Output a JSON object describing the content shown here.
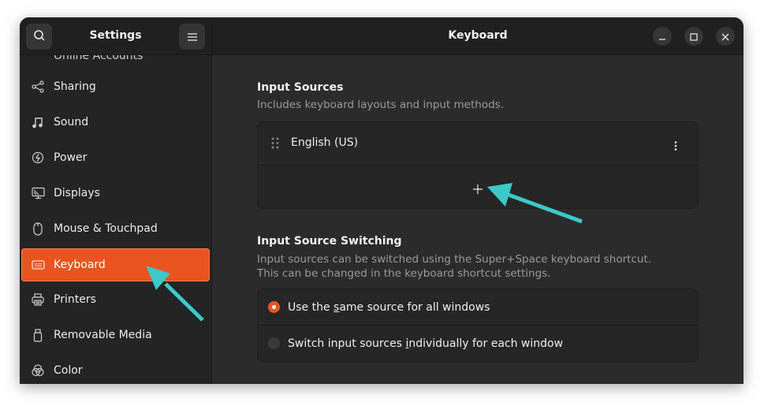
{
  "sidebar": {
    "title": "Settings",
    "search_icon": "search-icon",
    "menu_icon": "hamburger-menu-icon",
    "cut_off_item": "Online Accounts",
    "items": [
      {
        "label": "Sharing",
        "icon": "share-icon",
        "active": false
      },
      {
        "label": "Sound",
        "icon": "music-note-icon",
        "active": false
      },
      {
        "label": "Power",
        "icon": "power-icon",
        "active": false
      },
      {
        "label": "Displays",
        "icon": "display-icon",
        "active": false
      },
      {
        "label": "Mouse & Touchpad",
        "icon": "mouse-icon",
        "active": false
      },
      {
        "label": "Keyboard",
        "icon": "keyboard-icon",
        "active": true
      },
      {
        "label": "Printers",
        "icon": "printer-icon",
        "active": false
      },
      {
        "label": "Removable Media",
        "icon": "usb-drive-icon",
        "active": false
      },
      {
        "label": "Color",
        "icon": "color-icon",
        "active": false
      }
    ]
  },
  "header": {
    "title": "Keyboard",
    "minimize_icon": "minimize-icon",
    "maximize_icon": "maximize-icon",
    "close_icon": "close-icon"
  },
  "input_sources": {
    "title": "Input Sources",
    "subtitle": "Includes keyboard layouts and input methods.",
    "sources": [
      {
        "label": "English (US)"
      }
    ],
    "add_icon": "plus-icon"
  },
  "switching": {
    "title": "Input Source Switching",
    "subtitle_line1": "Input sources can be switched using the Super+Space keyboard shortcut.",
    "subtitle_line2": "This can be changed in the keyboard shortcut settings.",
    "options": [
      {
        "pre": "Use the ",
        "mnemonic": "s",
        "post": "ame source for all windows",
        "selected": true
      },
      {
        "pre": "Switch input sources ",
        "mnemonic": "i",
        "post": "ndividually for each window",
        "selected": false
      }
    ]
  },
  "colors": {
    "accent": "#e95420",
    "annotation_arrow": "#3cc9c9"
  }
}
